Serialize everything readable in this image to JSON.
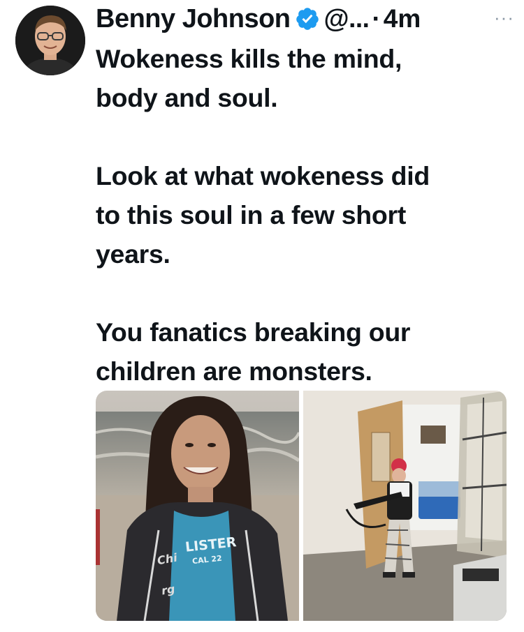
{
  "author": {
    "name": "Benny Johnson",
    "handle": "@...",
    "separator": "·",
    "time": "4m",
    "avatar": "author-avatar",
    "verified_icon": "verified-badge-icon",
    "verified_color": "#1d9bf0"
  },
  "more_label": "···",
  "tweet": {
    "lines": [
      "Wokeness kills the mind,",
      "body and soul.",
      "",
      "Look at what wokeness did",
      "to this soul in a few short",
      "years.",
      "",
      "You fanatics breaking our",
      "children are monsters."
    ]
  },
  "media": {
    "left_photo": {
      "shirt_text_1": "LISTER",
      "shirt_text_2": "CAL 22",
      "jacket_text_1": "Chi",
      "jacket_text_2": "rg"
    },
    "right_photo": {
      "scene": "security-camera-hallway"
    }
  },
  "colors": {
    "text": "#0f1419",
    "muted": "#8b98a5",
    "accent": "#1d9bf0"
  }
}
